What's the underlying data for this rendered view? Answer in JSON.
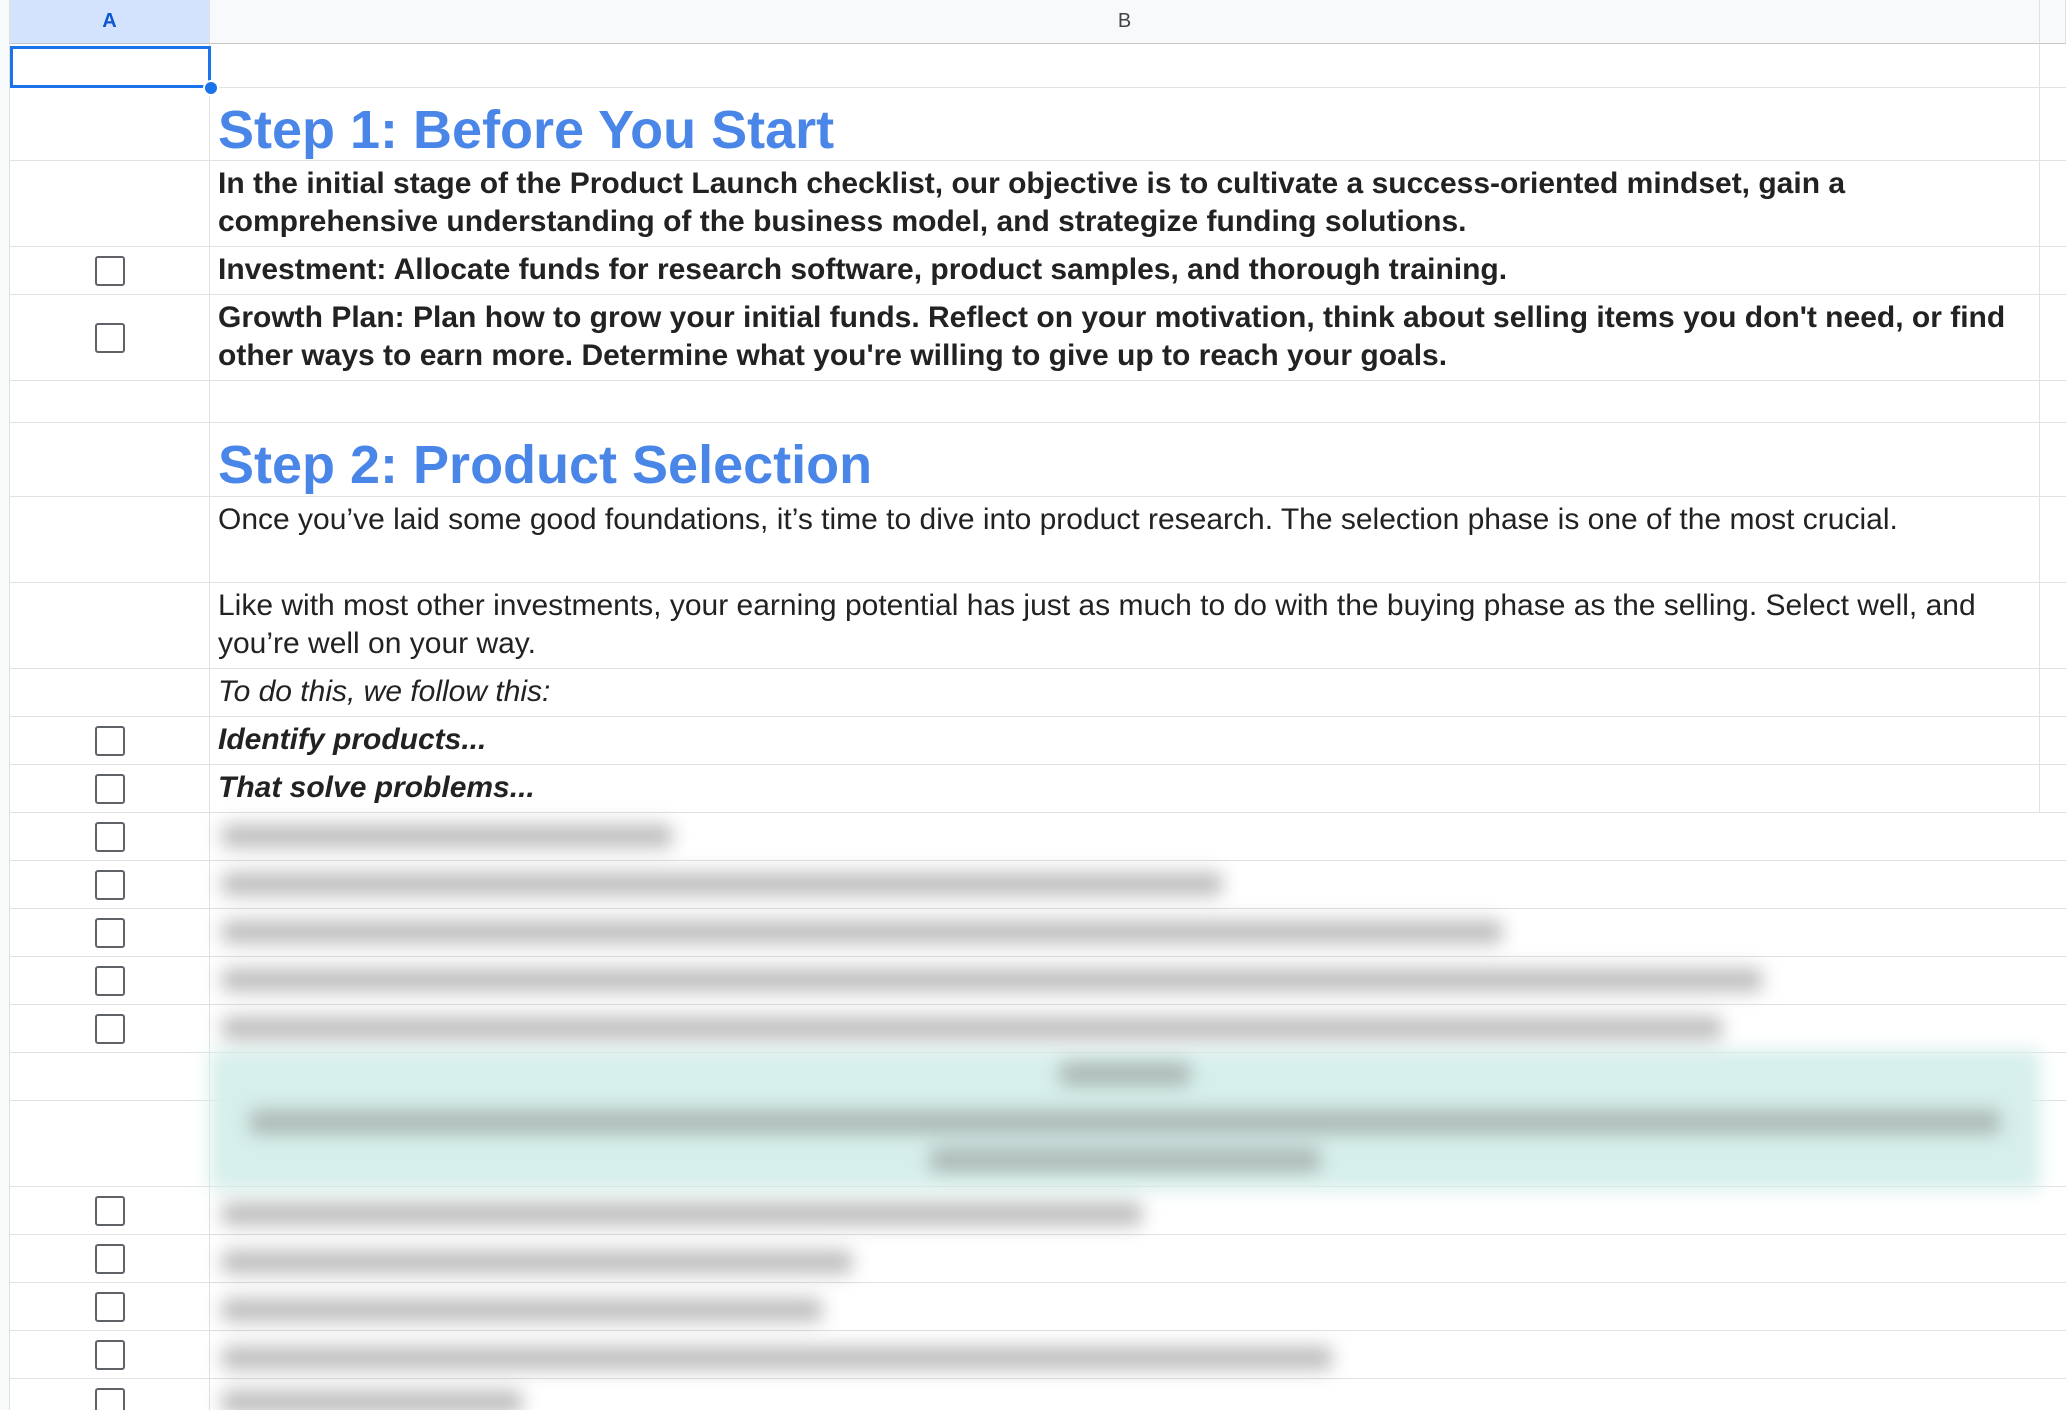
{
  "columns": {
    "a": "A",
    "b": "B"
  },
  "rows": {
    "step1_heading": "Step 1: Before You Start",
    "step1_intro": "In the initial stage of the Product Launch checklist, our objective is to cultivate a success-oriented mindset, gain a comprehensive understanding of the business model, and strategize funding solutions.",
    "investment": "Investment: Allocate funds for research software, product samples, and thorough training.",
    "growth_plan": "Growth Plan: Plan how to grow your initial funds. Reflect on your motivation, think about selling items you don't need, or find other ways to earn more. Determine what you're willing to give up to reach your goals.",
    "step2_heading": "Step 2: Product Selection",
    "step2_intro": "Once you’ve laid some good foundations, it’s time to dive into product research. The selection phase is one of the most crucial.",
    "step2_para": "Like with most other investments, your earning potential has just as much to do with the buying phase as the selling. Select well, and you’re well on your way.",
    "follow_this": "To do this, we follow this:",
    "identify_products": "Identify products...",
    "solve_problems": "That solve problems..."
  },
  "colors": {
    "heading": "#4a86e8",
    "selection": "#1a73e8",
    "tip_fill": "#d6efeb"
  },
  "icons": [
    "checkbox-icon"
  ]
}
